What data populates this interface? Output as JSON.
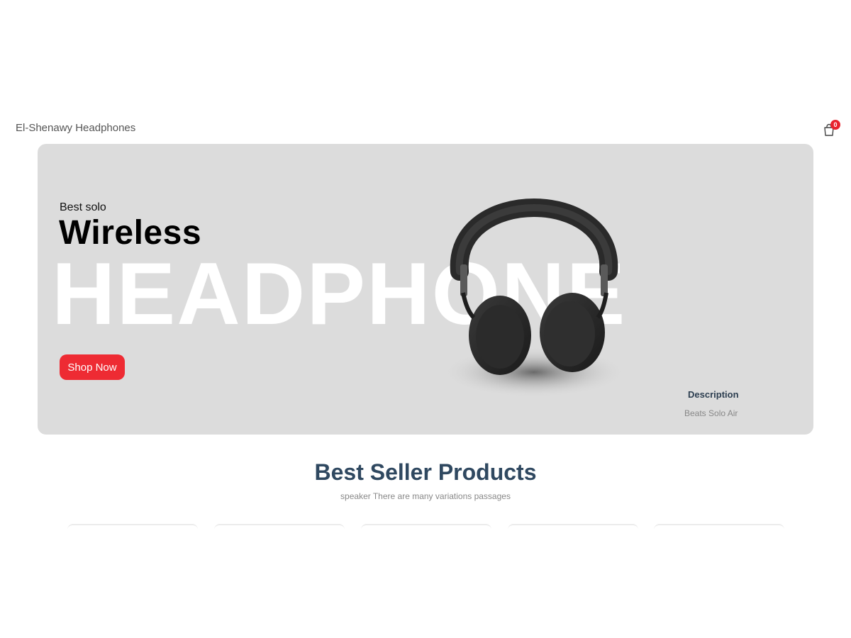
{
  "navbar": {
    "brand": "El-Shenawy Headphones",
    "cart_count": "0"
  },
  "hero": {
    "subtitle": "Best solo",
    "title": "Wireless",
    "big_text": "HEADPHONE",
    "button_label": "Shop Now",
    "description_title": "Description",
    "description_text": "Beats Solo Air"
  },
  "best_sellers": {
    "title": "Best Seller Products",
    "subtitle": "speaker There are many variations passages"
  },
  "colors": {
    "accent": "#ee2b33",
    "hero_bg": "#dcdcdc",
    "heading": "#2f4860"
  },
  "icons": {
    "cart": "shopping-bag-icon"
  }
}
